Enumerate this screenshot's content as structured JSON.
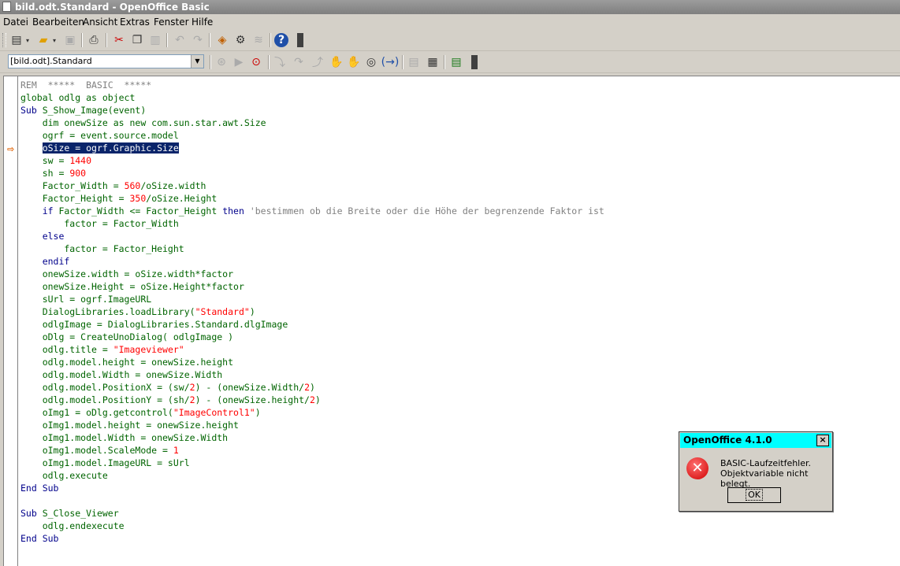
{
  "window": {
    "title": "bild.odt.Standard - OpenOffice Basic"
  },
  "menu": [
    "Datei",
    "Bearbeiten",
    "Ansicht",
    "Extras",
    "Fenster",
    "Hilfe"
  ],
  "library_selector": {
    "value": "[bild.odt].Standard"
  },
  "code_lines": [
    [
      [
        "REM  *****  BASIC  *****",
        "cm"
      ]
    ],
    [
      [
        "global odlg as object",
        "id"
      ]
    ],
    [
      [
        "Sub ",
        "kw"
      ],
      [
        "S_Show_Image(event)",
        "id"
      ]
    ],
    [
      [
        "    dim onewSize as new com.sun.star.awt.Size",
        "id"
      ]
    ],
    [
      [
        "    ogrf = event.source.model",
        "id"
      ]
    ],
    [
      [
        "    ",
        "id"
      ],
      [
        "oSize = ogrf.Graphic.Size",
        "hl"
      ]
    ],
    [
      [
        "    sw = ",
        "id"
      ],
      [
        "1440",
        "num"
      ]
    ],
    [
      [
        "    sh = ",
        "id"
      ],
      [
        "900",
        "num"
      ]
    ],
    [
      [
        "    Factor_Width = ",
        "id"
      ],
      [
        "560",
        "num"
      ],
      [
        "/oSize.width",
        "id"
      ]
    ],
    [
      [
        "    Factor_Height = ",
        "id"
      ],
      [
        "350",
        "num"
      ],
      [
        "/oSize.Height",
        "id"
      ]
    ],
    [
      [
        "    if ",
        "kw"
      ],
      [
        "Factor_Width <= Factor_Height ",
        "id"
      ],
      [
        "then ",
        "kw"
      ],
      [
        "'bestimmen ob die Breite oder die Höhe der begrenzende Faktor ist",
        "cm"
      ]
    ],
    [
      [
        "        factor = Factor_Width",
        "id"
      ]
    ],
    [
      [
        "    else",
        "kw"
      ]
    ],
    [
      [
        "        factor = Factor_Height",
        "id"
      ]
    ],
    [
      [
        "    endif",
        "kw"
      ]
    ],
    [
      [
        "    onewSize.width = oSize.width*factor",
        "id"
      ]
    ],
    [
      [
        "    onewSize.Height = oSize.Height*factor",
        "id"
      ]
    ],
    [
      [
        "    sUrl = ogrf.ImageURL",
        "id"
      ]
    ],
    [
      [
        "    DialogLibraries.loadLibrary(",
        "id"
      ],
      [
        "\"Standard\"",
        "str"
      ],
      [
        ")",
        "id"
      ]
    ],
    [
      [
        "    odlgImage = DialogLibraries.Standard.dlgImage",
        "id"
      ]
    ],
    [
      [
        "    oDlg = CreateUnoDialog( odlgImage )",
        "id"
      ]
    ],
    [
      [
        "    odlg.title = ",
        "id"
      ],
      [
        "\"Imageviewer\"",
        "str"
      ]
    ],
    [
      [
        "    odlg.model.height = onewSize.height",
        "id"
      ]
    ],
    [
      [
        "    odlg.model.Width = onewSize.Width",
        "id"
      ]
    ],
    [
      [
        "    odlg.model.PositionX = (sw/",
        "id"
      ],
      [
        "2",
        "num"
      ],
      [
        ") - (onewSize.Width/",
        "id"
      ],
      [
        "2",
        "num"
      ],
      [
        ")",
        "id"
      ]
    ],
    [
      [
        "    odlg.model.PositionY = (sh/",
        "id"
      ],
      [
        "2",
        "num"
      ],
      [
        ") - (onewSize.height/",
        "id"
      ],
      [
        "2",
        "num"
      ],
      [
        ")",
        "id"
      ]
    ],
    [
      [
        "    oImg1 = oDlg.getcontrol(",
        "id"
      ],
      [
        "\"ImageControl1\"",
        "str"
      ],
      [
        ")",
        "id"
      ]
    ],
    [
      [
        "    oImg1.model.height = onewSize.height",
        "id"
      ]
    ],
    [
      [
        "    oImg1.model.Width = onewSize.Width",
        "id"
      ]
    ],
    [
      [
        "    oImg1.model.ScaleMode = ",
        "id"
      ],
      [
        "1",
        "num"
      ]
    ],
    [
      [
        "    oImg1.model.ImageURL = sUrl",
        "id"
      ]
    ],
    [
      [
        "    odlg.execute",
        "id"
      ]
    ],
    [
      [
        "End Sub",
        "kw"
      ]
    ],
    [
      [
        "",
        "id"
      ]
    ],
    [
      [
        "Sub ",
        "kw"
      ],
      [
        "S_Close_Viewer",
        "id"
      ]
    ],
    [
      [
        "    odlg.endexecute",
        "id"
      ]
    ],
    [
      [
        "End Sub",
        "kw"
      ]
    ]
  ],
  "dialog": {
    "title": "OpenOffice 4.1.0",
    "close": "×",
    "line1": "BASIC-Laufzeitfehler.",
    "line2": "Objektvariable nicht belegt.",
    "ok_label": "OK"
  }
}
